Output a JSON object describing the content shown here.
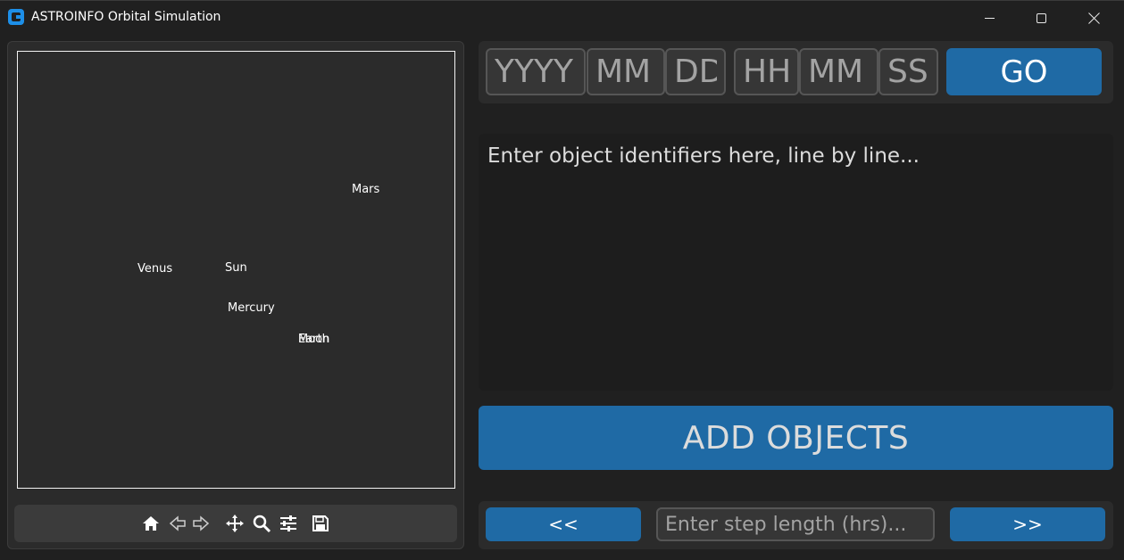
{
  "window": {
    "title": "ASTROINFO Orbital Simulation"
  },
  "plot": {
    "labels": [
      {
        "name": "Mars"
      },
      {
        "name": "Venus"
      },
      {
        "name": "Sun"
      },
      {
        "name": "Mercury"
      },
      {
        "name": "Earth"
      },
      {
        "name": "Moon"
      }
    ],
    "toolbar_icons": [
      "home-icon",
      "back-arrow-icon",
      "forward-arrow-icon",
      "pan-icon",
      "zoom-icon",
      "configure-subplots-icon",
      "save-icon"
    ]
  },
  "datetime": {
    "year_placeholder": "YYYY",
    "month_placeholder": "MM",
    "day_placeholder": "DD",
    "hour_placeholder": "HH",
    "minute_placeholder": "MM",
    "second_placeholder": "SS",
    "go_label": "GO"
  },
  "objects": {
    "placeholder": "Enter object identifiers here, line by line...",
    "add_label": "ADD OBJECTS"
  },
  "step": {
    "prev_label": "<<",
    "next_label": ">>",
    "placeholder": "Enter step length (hrs)..."
  },
  "colors": {
    "accent": "#1f6aa5",
    "background": "#202020",
    "panel": "#2b2b2b"
  }
}
